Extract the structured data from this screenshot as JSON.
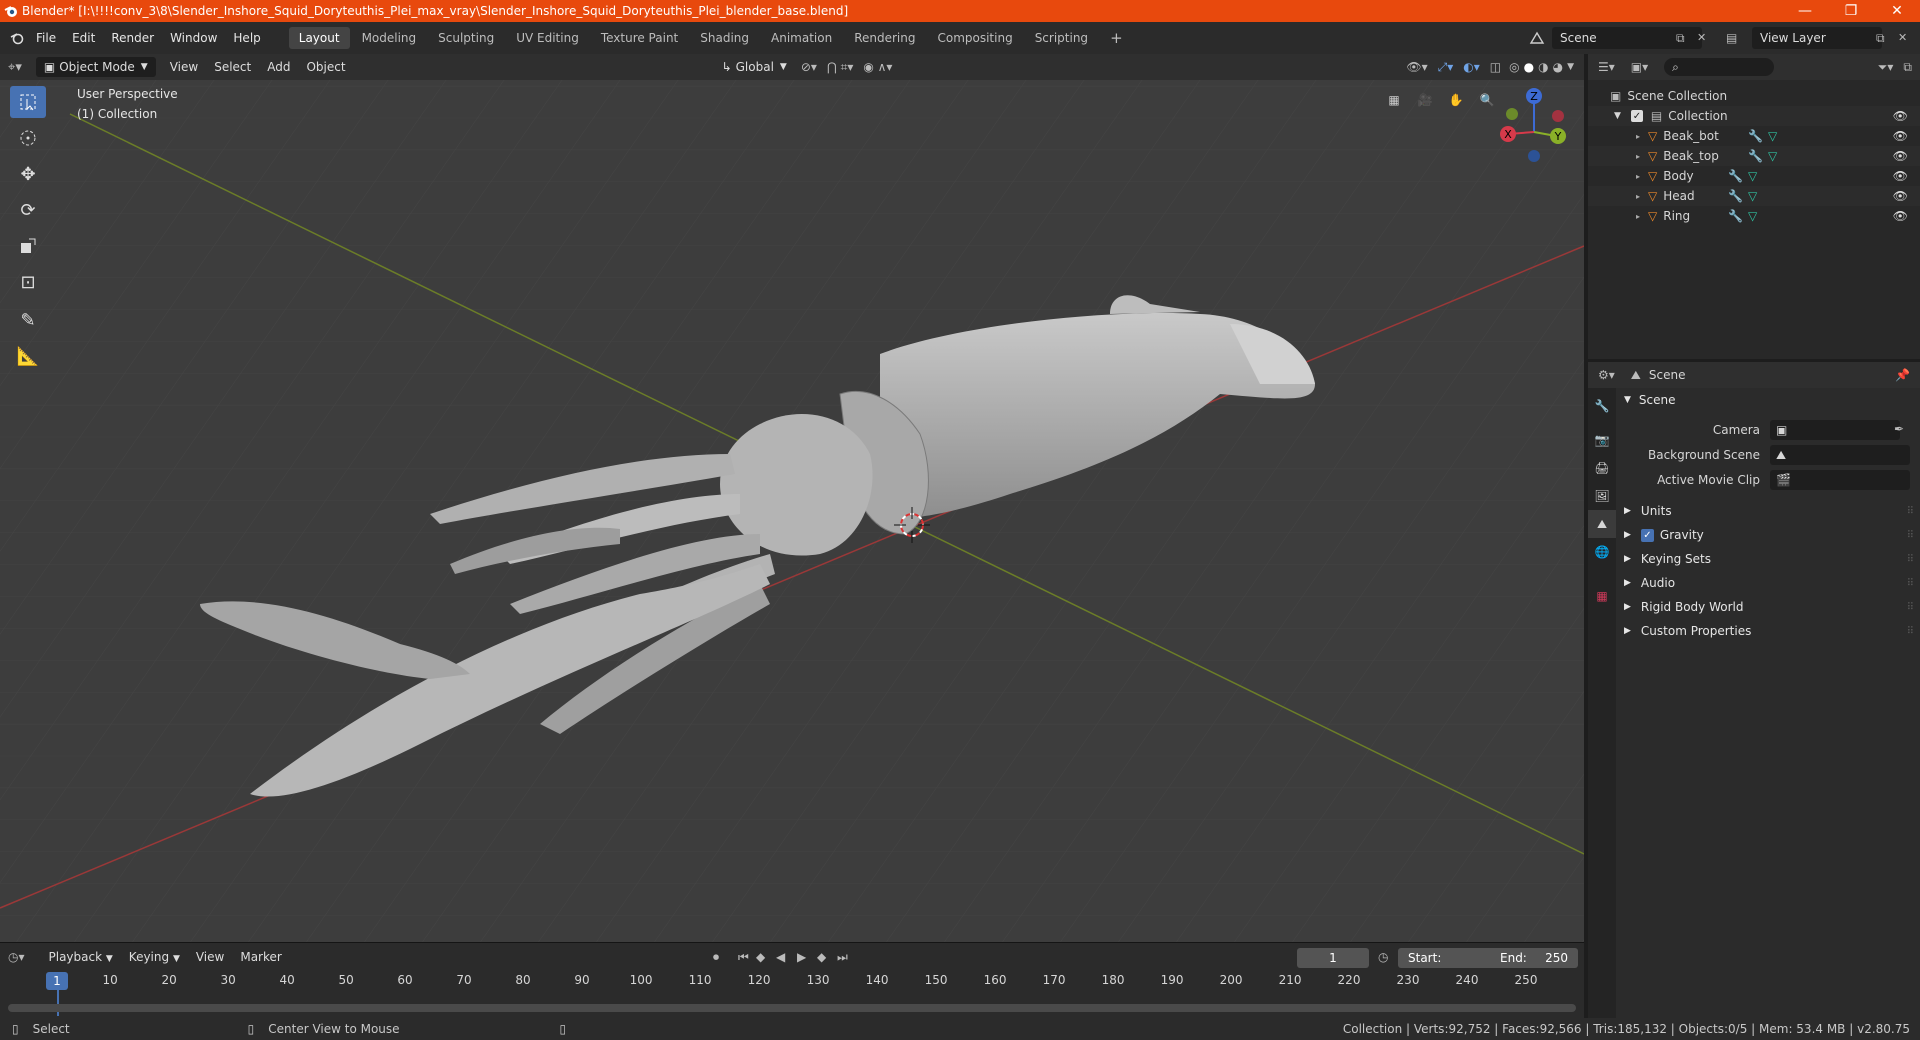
{
  "window": {
    "title": "Blender* [I:\\!!!!conv_3\\8\\Slender_Inshore_Squid_Doryteuthis_Plei_max_vray\\Slender_Inshore_Squid_Doryteuthis_Plei_blender_base.blend]",
    "minimize": "—",
    "maximize": "❐",
    "close": "✕"
  },
  "menu": [
    "File",
    "Edit",
    "Render",
    "Window",
    "Help"
  ],
  "workspaces": [
    "Layout",
    "Modeling",
    "Sculpting",
    "UV Editing",
    "Texture Paint",
    "Shading",
    "Animation",
    "Rendering",
    "Compositing",
    "Scripting"
  ],
  "active_workspace": "Layout",
  "scene_name": "Scene",
  "view_layer": "View Layer",
  "viewport": {
    "mode": "Object Mode",
    "menus": [
      "View",
      "Select",
      "Add",
      "Object"
    ],
    "orientation": "Global",
    "info_line1": "User Perspective",
    "info_line2": "(1) Collection",
    "gizmo": {
      "z": "Z",
      "x": "X",
      "y": "Y"
    }
  },
  "outliner": {
    "root": "Scene Collection",
    "collection": "Collection",
    "objects": [
      "Beak_bot",
      "Beak_top",
      "Body",
      "Head",
      "Ring"
    ]
  },
  "properties": {
    "header": "Scene",
    "panel": "Scene",
    "fields": [
      {
        "label": "Camera"
      },
      {
        "label": "Background Scene"
      },
      {
        "label": "Active Movie Clip"
      }
    ],
    "sections": [
      "Units",
      "Gravity",
      "Keying Sets",
      "Audio",
      "Rigid Body World",
      "Custom Properties"
    ]
  },
  "timeline": {
    "menus": [
      "Playback",
      "Keying",
      "View",
      "Marker"
    ],
    "current_frame": "1",
    "start_label": "Start:",
    "start": "1",
    "end_label": "End:",
    "end": "250",
    "ruler": [
      "1",
      "10",
      "20",
      "30",
      "40",
      "50",
      "60",
      "70",
      "80",
      "90",
      "100",
      "110",
      "120",
      "130",
      "140",
      "150",
      "160",
      "170",
      "180",
      "190",
      "200",
      "210",
      "220",
      "230",
      "240",
      "250"
    ]
  },
  "status": {
    "select": "Select",
    "center": "Center View to Mouse",
    "stats": "Collection | Verts:92,752 | Faces:92,566 | Tris:185,132 | Objects:0/5 | Mem: 53.4 MB | v2.80.75"
  }
}
